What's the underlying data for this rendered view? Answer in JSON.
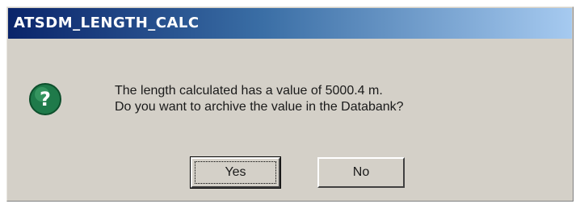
{
  "window": {
    "title": "ATSDM_LENGTH_CALC"
  },
  "message": {
    "line1": "The length calculated has a value of 5000.4 m.",
    "line2": "Do you want to archive the value in the Databank?"
  },
  "icon": {
    "name": "question-icon",
    "glyph": "?",
    "color": "#1f7a4a"
  },
  "buttons": {
    "yes": "Yes",
    "no": "No"
  },
  "colors": {
    "titlebar_start": "#0a246a",
    "titlebar_end": "#a6caf0",
    "dialog_background": "#d4d0c8"
  }
}
